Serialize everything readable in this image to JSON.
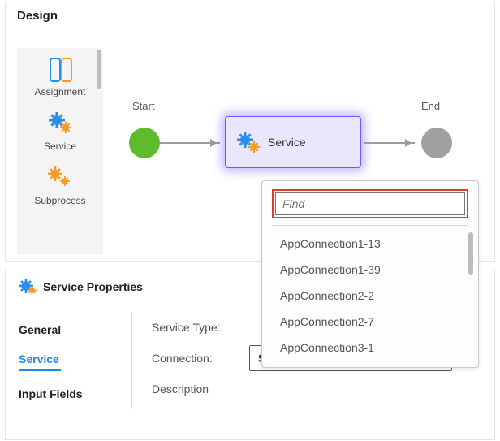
{
  "design": {
    "title": "Design",
    "palette": [
      {
        "label": "Assignment"
      },
      {
        "label": "Service"
      },
      {
        "label": "Subprocess"
      }
    ],
    "start_label": "Start",
    "end_label": "End",
    "service_node_label": "Service"
  },
  "properties": {
    "title": "Service Properties",
    "tabs": {
      "general": "General",
      "service": "Service",
      "input_fields": "Input Fields"
    },
    "fields": {
      "service_type": "Service Type:",
      "connection": "Connection:",
      "description": "Description"
    },
    "connection_select_value": "Select"
  },
  "dropdown": {
    "find_placeholder": "Find",
    "items": [
      "AppConnection1-13",
      "AppConnection1-39",
      "AppConnection2-2",
      "AppConnection2-7",
      "AppConnection3-1"
    ]
  }
}
